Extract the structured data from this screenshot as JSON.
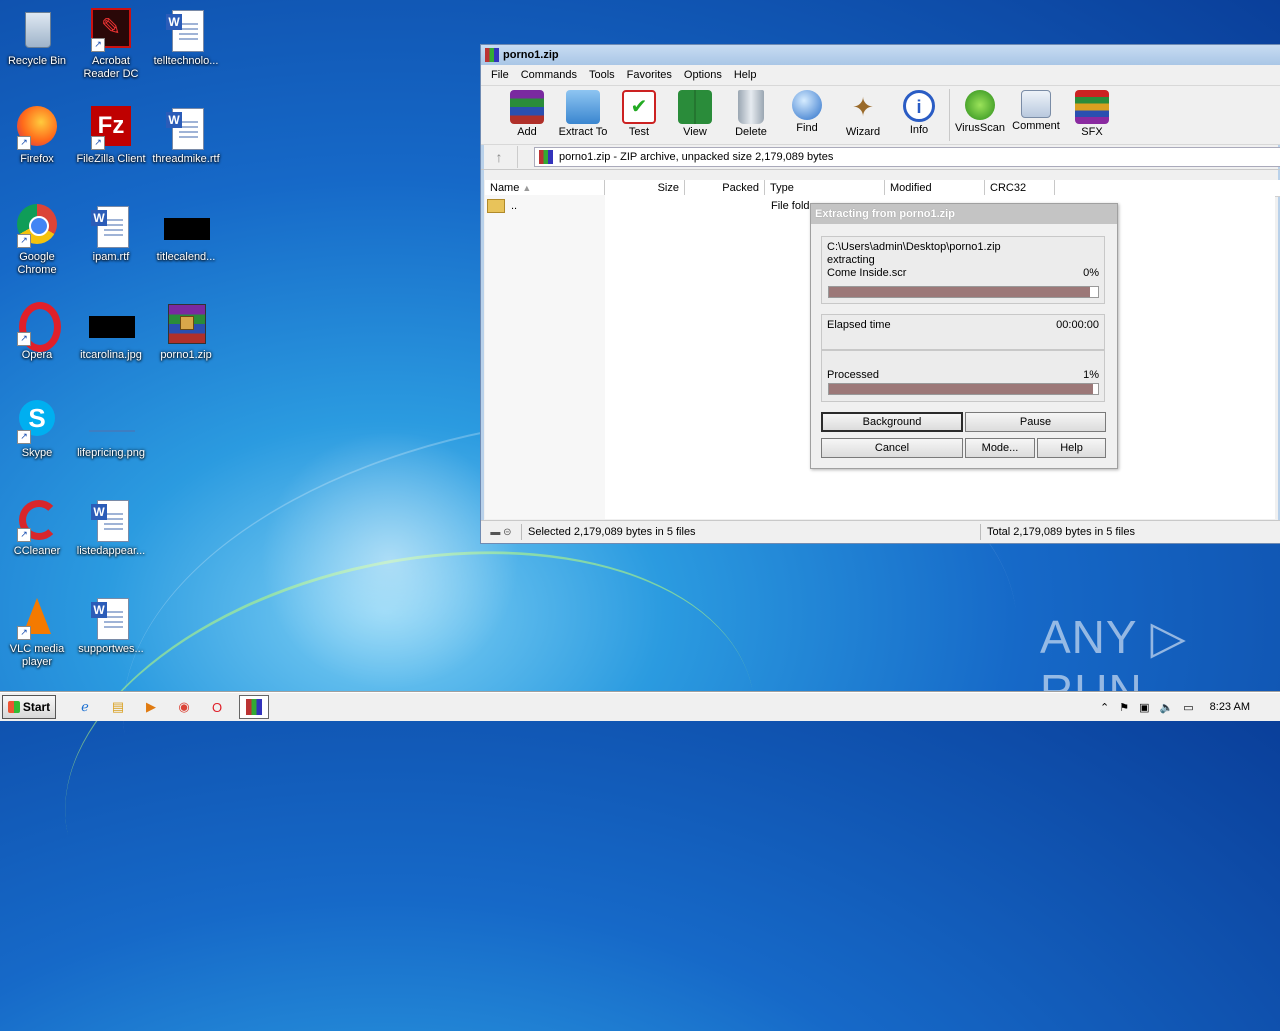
{
  "desktop": {
    "icons": [
      {
        "label": "Recycle Bin"
      },
      {
        "label": "Acrobat Reader DC"
      },
      {
        "label": "telltechnolo..."
      },
      {
        "label": "Firefox"
      },
      {
        "label": "FileZilla Client"
      },
      {
        "label": "threadmike.rtf"
      },
      {
        "label": "Google Chrome"
      },
      {
        "label": "ipam.rtf"
      },
      {
        "label": "titlecalend..."
      },
      {
        "label": "Opera"
      },
      {
        "label": "itcarolina.jpg"
      },
      {
        "label": "porno1.zip"
      },
      {
        "label": "Skype"
      },
      {
        "label": "lifepricing.png"
      },
      {
        "label": "CCleaner"
      },
      {
        "label": "listedappear..."
      },
      {
        "label": "VLC media player"
      },
      {
        "label": "supportwes..."
      }
    ]
  },
  "winrar": {
    "title": "porno1.zip",
    "menu": [
      "File",
      "Commands",
      "Tools",
      "Favorites",
      "Options",
      "Help"
    ],
    "toolbar": [
      "Add",
      "Extract To",
      "Test",
      "View",
      "Delete",
      "Find",
      "Wizard",
      "Info",
      "VirusScan",
      "Comment",
      "SFX"
    ],
    "toolbar_icons": [
      "add-icon",
      "extract-to-icon",
      "test-icon",
      "view-icon",
      "delete-icon",
      "find-icon",
      "wizard-icon",
      "info-icon",
      "virusscan-icon",
      "comment-icon",
      "sfx-icon"
    ],
    "address": "porno1.zip - ZIP archive, unpacked size 2,179,089 bytes",
    "columns": [
      "Name",
      "Size",
      "Packed",
      "Type",
      "Modified",
      "CRC32"
    ],
    "rows": [
      {
        "name": "..",
        "type": "File fold"
      }
    ],
    "status_left": "Selected 2,179,089 bytes in 5 files",
    "status_right": "Total 2,179,089 bytes in 5 files"
  },
  "extract_dialog": {
    "title": "Extracting from porno1.zip",
    "path": "C:\\Users\\admin\\Desktop\\porno1.zip",
    "action": "extracting",
    "file": "Come Inside.scr",
    "file_percent": "0%",
    "file_progress": 0.97,
    "elapsed_label": "Elapsed time",
    "elapsed_value": "00:00:00",
    "processed_label": "Processed",
    "processed_percent": "1%",
    "processed_progress": 0.98,
    "buttons": {
      "background": "Background",
      "pause": "Pause",
      "cancel": "Cancel",
      "mode": "Mode...",
      "help": "Help"
    }
  },
  "watermark": "ANY ▷ RUN",
  "taskbar": {
    "start": "Start",
    "clock": "8:23 AM"
  }
}
